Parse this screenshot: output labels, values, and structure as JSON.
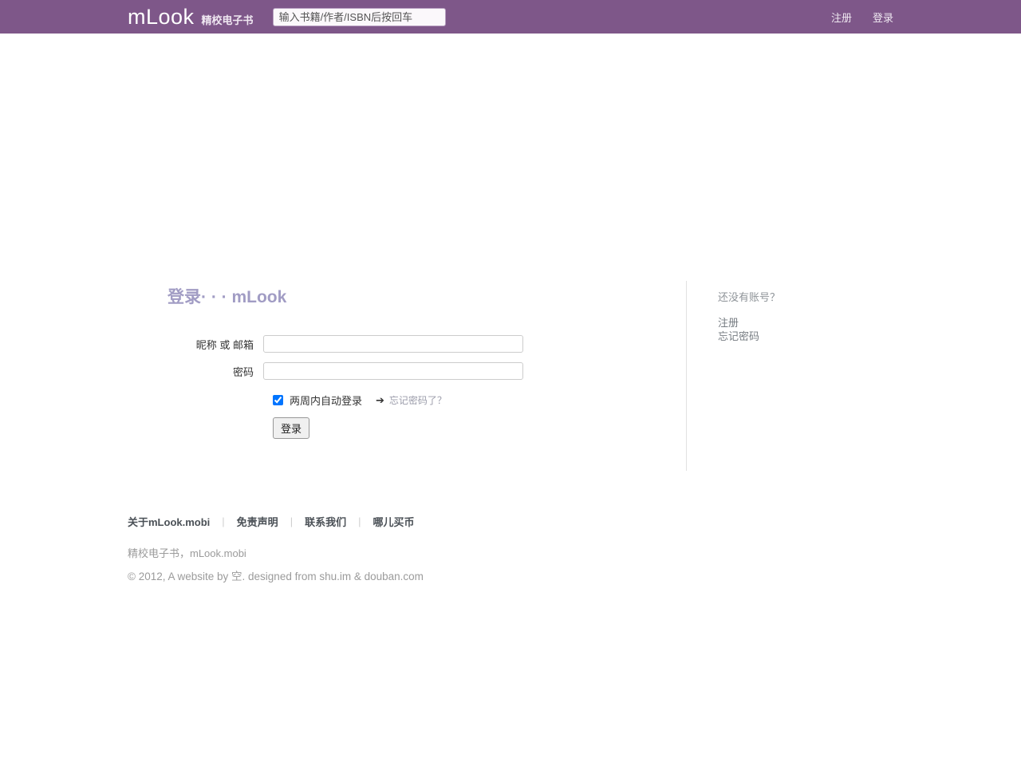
{
  "header": {
    "logo": "mLook",
    "tagline": "精校电子书",
    "search_placeholder": "输入书籍/作者/ISBN后按回车",
    "nav": {
      "register": "注册",
      "login": "登录"
    }
  },
  "login": {
    "title": "登录· · · mLook",
    "username_label": "昵称 或 邮箱",
    "username_value": "",
    "password_label": "密码",
    "password_value": "",
    "remember_label": "两周内自动登录",
    "checkbox_checked": "checked",
    "arrow": "➔",
    "forgot_link": "忘记密码了？",
    "submit_label": "登录"
  },
  "sidebar": {
    "no_account": "还没有账号？",
    "register_link": "注册",
    "forgot_link": "忘记密码"
  },
  "footer": {
    "links": [
      "关于mLook.mobi",
      "免责声明",
      "联系我们",
      "哪儿买币"
    ],
    "separator": "|",
    "site_line": "精校电子书，mLook.mobi",
    "copyright": "© 2012, A website by 空. designed from shu.im & douban.com"
  },
  "colors": {
    "header_bg": "#7e5789",
    "title_text": "#a19cc4",
    "divider": "#e1e1e1"
  }
}
